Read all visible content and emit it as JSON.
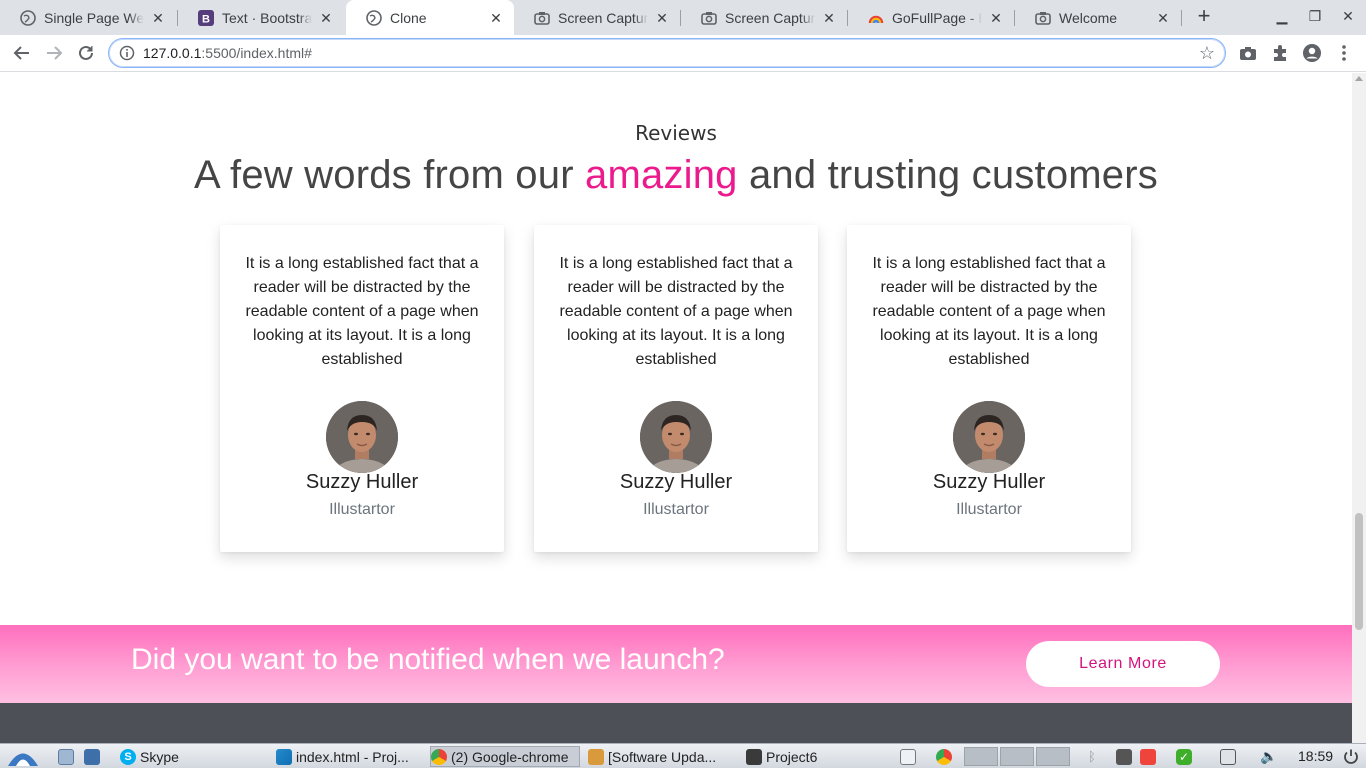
{
  "browser": {
    "tabs": [
      {
        "title": "Single Page We",
        "active": false
      },
      {
        "title": "Text · Bootstra",
        "active": false
      },
      {
        "title": "Clone",
        "active": true
      },
      {
        "title": "Screen Capture",
        "active": false
      },
      {
        "title": "Screen Capture",
        "active": false
      },
      {
        "title": "GoFullPage - Fu",
        "active": false
      },
      {
        "title": "Welcome",
        "active": false
      }
    ],
    "url_host": "127.0.0.1",
    "url_rest": ":5500/index.html#"
  },
  "reviews": {
    "eyebrow": "Reviews",
    "heading_before": "A few words from our ",
    "heading_accent": "amazing",
    "heading_after": " and trusting customers",
    "accent_color": "#ec1b8d",
    "cards": [
      {
        "quote": "It is a long established fact that a reader will be distracted by the readable content of a page when looking at its layout. It is a long established",
        "name": "Suzzy Huller",
        "role": "Illustartor"
      },
      {
        "quote": "It is a long established fact that a reader will be distracted by the readable content of a page when looking at its layout. It is a long established",
        "name": "Suzzy Huller",
        "role": "Illustartor"
      },
      {
        "quote": "It is a long established fact that a reader will be distracted by the readable content of a page when looking at its layout. It is a long established",
        "name": "Suzzy Huller",
        "role": "Illustartor"
      }
    ]
  },
  "cta": {
    "text": "Did you want to be notified when we launch?",
    "button": "Learn More"
  },
  "taskbar": {
    "items": [
      {
        "label": "Skype"
      },
      {
        "label": "index.html - Proj..."
      },
      {
        "label": "(2) Google-chrome"
      },
      {
        "label": "[Software Upda..."
      },
      {
        "label": "Project6"
      }
    ],
    "clock": "18:59"
  }
}
